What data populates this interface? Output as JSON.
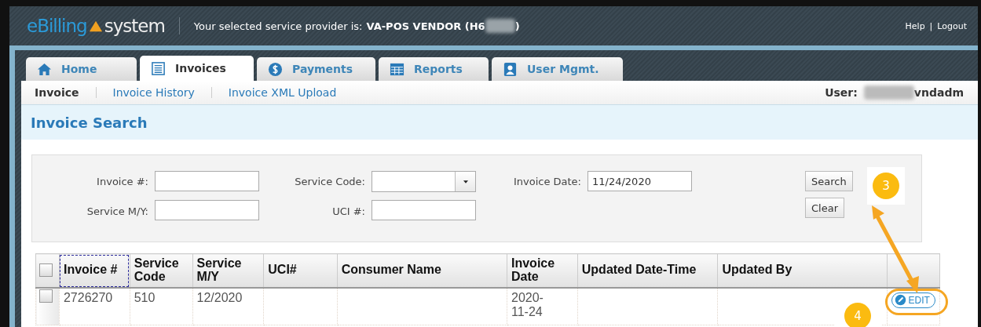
{
  "header": {
    "logo_left": "eBilling",
    "logo_right": "system",
    "provider_label": "Your selected service provider is:",
    "provider_value": "VA-POS VENDOR (H6",
    "provider_end": ")",
    "links": [
      "Help",
      "Logout"
    ],
    "link_separator": "|"
  },
  "tabs": [
    {
      "label": "Home",
      "kind": "home",
      "selected": false
    },
    {
      "label": "Invoices",
      "kind": "document",
      "selected": true
    },
    {
      "label": "Payments",
      "kind": "dollar",
      "selected": false
    },
    {
      "label": "Reports",
      "kind": "grid",
      "selected": false
    },
    {
      "label": "User Mgmt.",
      "kind": "person",
      "selected": false
    }
  ],
  "subnav": [
    {
      "label": "Invoice",
      "selected": true
    },
    {
      "label": "Invoice History",
      "selected": false
    },
    {
      "label": "Invoice XML Upload",
      "selected": false
    }
  ],
  "user": {
    "label": "User:",
    "value": "vndadm"
  },
  "page_title": "Invoice Search",
  "search_form": {
    "fields": [
      {
        "label": "Invoice #:",
        "kind": "text"
      },
      {
        "label": "Service Code:",
        "kind": "select"
      },
      {
        "label": "Invoice Date:",
        "kind": "text",
        "value": "11/24/2020"
      },
      {
        "label": "Service M/Y:",
        "kind": "text"
      },
      {
        "label": "UCI #:",
        "kind": "text"
      }
    ],
    "buttons": [
      "Search",
      "Clear"
    ]
  },
  "table": {
    "header_checked": false,
    "columns": [
      "Invoice #",
      "Service Code",
      "Service M/Y",
      "UCI#",
      "Consumer Name",
      "Invoice Date",
      "Updated Date-Time",
      "Updated By"
    ],
    "rows": [
      {
        "checked": false,
        "cells": [
          "2726270",
          "510",
          "12/2020",
          "",
          "",
          "2020-11-24",
          "",
          ""
        ],
        "action": "EDIT"
      }
    ]
  },
  "annotations": [
    {
      "label": "3"
    },
    {
      "label": "4"
    }
  ]
}
